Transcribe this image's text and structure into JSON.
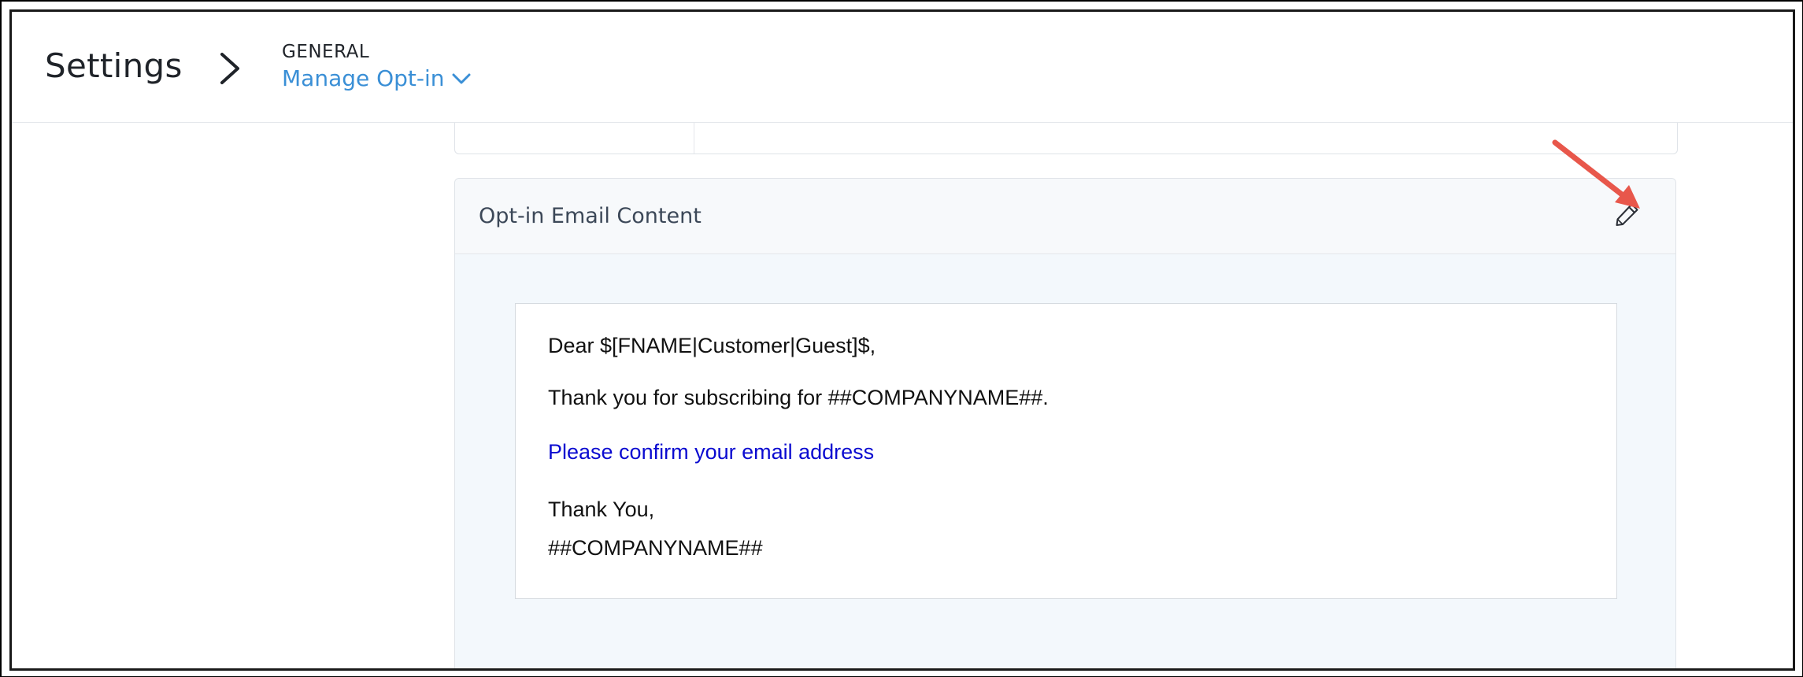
{
  "header": {
    "title": "Settings",
    "breadcrumb_section": "GENERAL",
    "breadcrumb_page": "Manage Opt-in"
  },
  "card": {
    "title": "Opt-in Email Content",
    "edit_icon": "pencil-icon"
  },
  "email": {
    "greeting": "Dear $[FNAME|Customer|Guest]$,",
    "body_line": "Thank you for subscribing for ##COMPANYNAME##.",
    "confirm_link": "Please confirm your email address",
    "signoff": "Thank You,",
    "signature": "##COMPANYNAME##"
  },
  "colors": {
    "link_blue": "#3a8fd6",
    "email_link": "#0a0ad0",
    "annotation_arrow": "#e8574b"
  }
}
